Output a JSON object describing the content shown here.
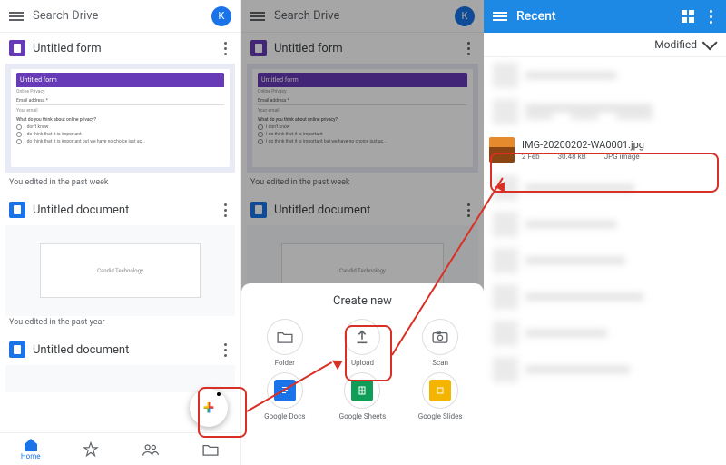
{
  "header": {
    "search_placeholder": "Search Drive",
    "avatar_letter": "K"
  },
  "items": [
    {
      "kind": "form",
      "title": "Untitled form",
      "status": "You edited in the past week",
      "thumb": {
        "title": "Untitled form",
        "sub": "Online Privacy",
        "q1": "Email address *",
        "hint": "Your email",
        "q2": "What do you think about online privacy?",
        "o1": "I don't know",
        "o2": "I do think that it is important",
        "o3": "I do think that it is important but we have no choice just ac..."
      }
    },
    {
      "kind": "doc",
      "title": "Untitled document",
      "status": "You edited in the past year",
      "thumb": {
        "text": "Candid Technology"
      }
    },
    {
      "kind": "doc",
      "title": "Untitled document"
    }
  ],
  "nav": {
    "home": "Home"
  },
  "sheet": {
    "title": "Create new",
    "options": {
      "folder": "Folder",
      "upload": "Upload",
      "scan": "Scan",
      "docs": "Google Docs",
      "sheets": "Google Sheets",
      "slides": "Google Slides"
    }
  },
  "recent": {
    "title": "Recent",
    "sort": "Modified",
    "highlight": {
      "name": "IMG-20200202-WA0001.jpg",
      "date": "2 Feb",
      "size": "30.48 kB",
      "type": "JPG image"
    }
  }
}
